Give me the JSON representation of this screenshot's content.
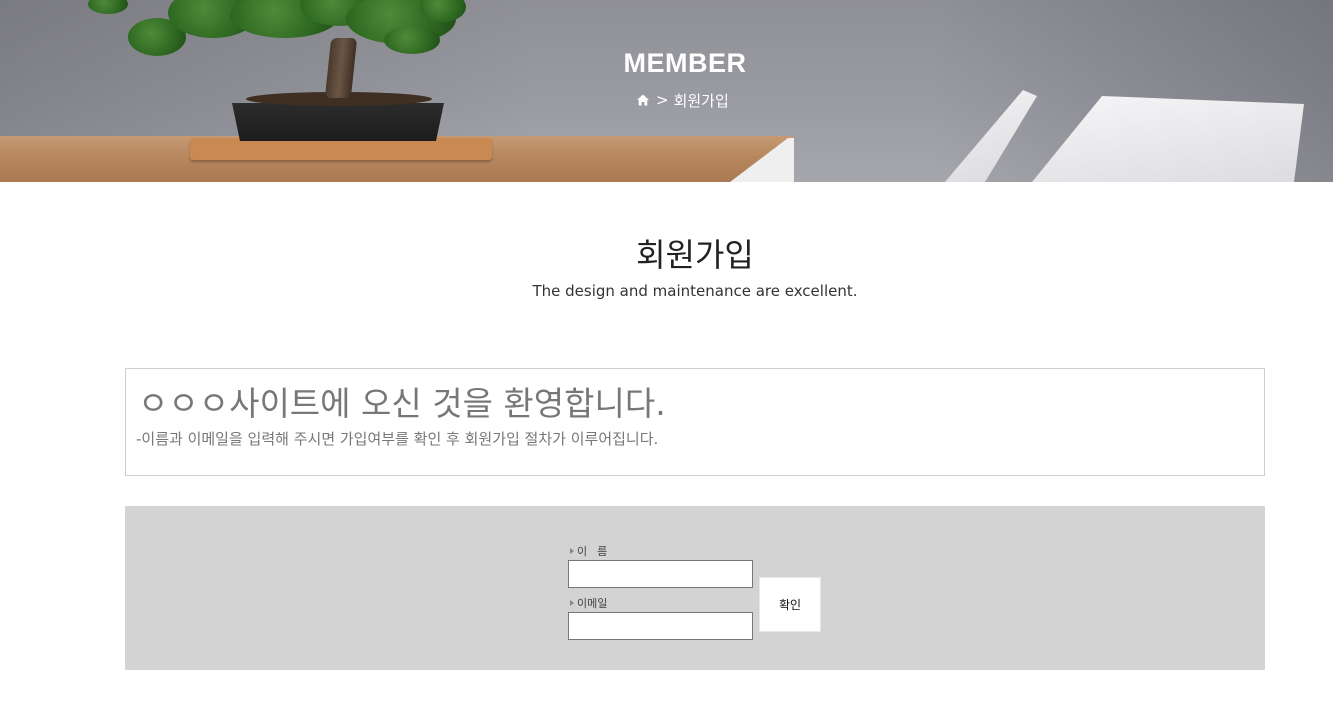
{
  "hero": {
    "title": "MEMBER",
    "breadcrumb": {
      "home_icon": "home-icon",
      "separator": ">",
      "current": "회원가입"
    }
  },
  "section": {
    "title": "회원가입",
    "subtitle": "The design and maintenance are excellent."
  },
  "welcome": {
    "title": "ㅇㅇㅇ사이트에 오신 것을 환영합니다.",
    "description": "-이름과 이메일을 입력해 주시면 가입여부를 확인 후 회원가입 절차가 이루어집니다."
  },
  "form": {
    "name_label": "이름",
    "name_value": "",
    "email_label": "이메일",
    "email_value": "",
    "submit_label": "확인"
  },
  "colors": {
    "form_panel_bg": "#d3d3d3",
    "welcome_text": "#777777",
    "border": "#cfcfcf"
  }
}
